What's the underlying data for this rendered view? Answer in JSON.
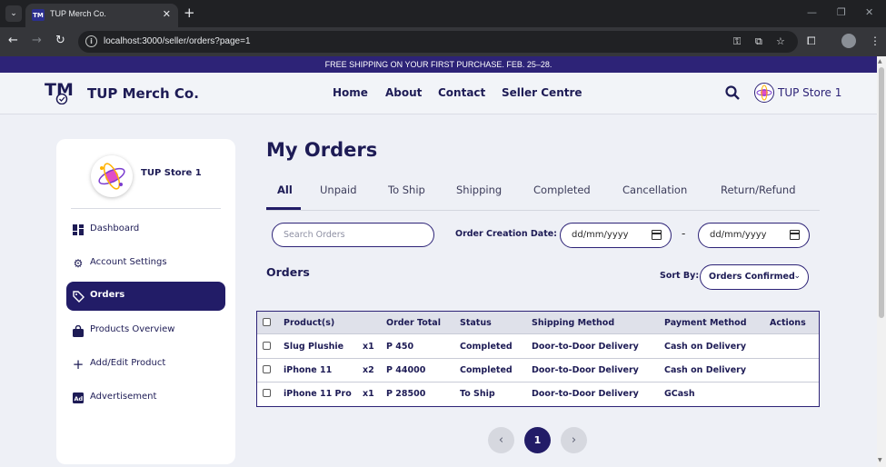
{
  "browser": {
    "tab_title": "TUP Merch Co.",
    "url": "localhost:3000/seller/orders?page=1"
  },
  "promo_banner": "FREE SHIPPING ON YOUR FIRST PURCHASE. FEB. 25–28.",
  "header": {
    "logo_text": "TM",
    "brand": "TUP Merch Co.",
    "nav": [
      "Home",
      "About",
      "Contact",
      "Seller Centre"
    ],
    "store_name": "TUP Store 1"
  },
  "sidebar": {
    "store_name": "TUP Store 1",
    "items": [
      {
        "label": "Dashboard",
        "icon": "dashboard-icon"
      },
      {
        "label": "Account Settings",
        "icon": "gear-icon"
      },
      {
        "label": "Orders",
        "icon": "tag-icon",
        "active": true
      },
      {
        "label": "Products Overview",
        "icon": "shopping-bag-icon"
      },
      {
        "label": "Add/Edit Product",
        "icon": "plus-icon"
      },
      {
        "label": "Advertisement",
        "icon": "ad-icon"
      }
    ]
  },
  "main": {
    "title": "My Orders",
    "tabs": [
      "All",
      "Unpaid",
      "To Ship",
      "Shipping",
      "Completed",
      "Cancellation",
      "Return/Refund"
    ],
    "active_tab": "All",
    "search_placeholder": "Search Orders",
    "date_label": "Order Creation Date:",
    "date_from": "dd/mm/yyyy",
    "date_to": "dd/mm/yyyy",
    "date_separator": "-",
    "orders_heading": "Orders",
    "sort_label": "Sort By:",
    "sort_value": "Orders Confirmed",
    "table": {
      "headers": [
        "Product(s)",
        "Order Total",
        "Status",
        "Shipping Method",
        "Payment Method",
        "Actions"
      ],
      "rows": [
        {
          "product": "Slug Plushie",
          "qty": "x1",
          "total": "P 450",
          "status": "Completed",
          "shipping": "Door-to-Door Delivery",
          "payment": "Cash on Delivery"
        },
        {
          "product": "iPhone 11",
          "qty": "x2",
          "total": "P 44000",
          "status": "Completed",
          "shipping": "Door-to-Door Delivery",
          "payment": "Cash on Delivery"
        },
        {
          "product": "iPhone 11 Pro",
          "qty": "x1",
          "total": "P 28500",
          "status": "To Ship",
          "shipping": "Door-to-Door Delivery",
          "payment": "GCash"
        }
      ]
    },
    "pagination": {
      "current": "1"
    }
  },
  "colors": {
    "primary": "#221c67",
    "promo_bg": "#2d2377",
    "page_bg": "#eef0f6"
  }
}
